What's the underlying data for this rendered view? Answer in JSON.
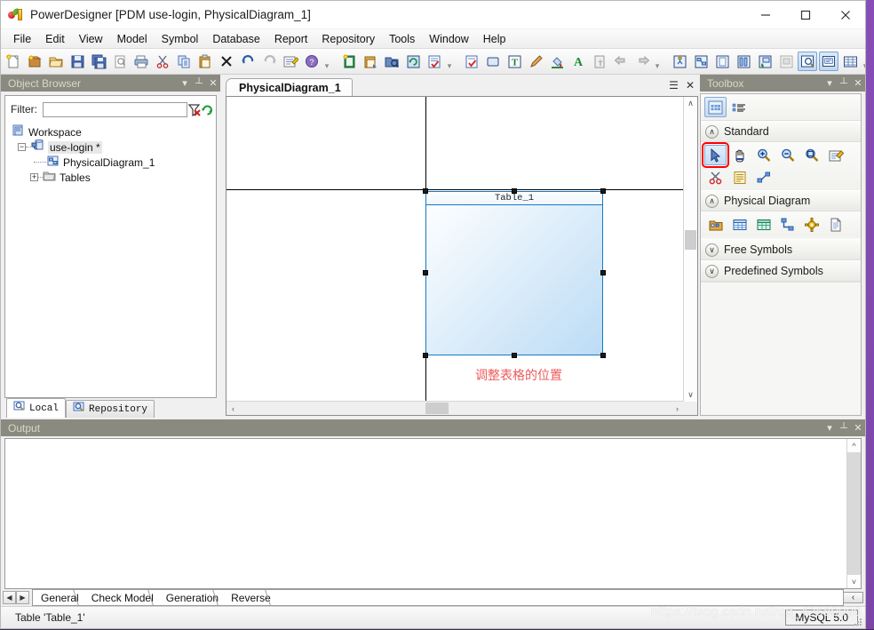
{
  "window": {
    "title": "PowerDesigner [PDM use-login, PhysicalDiagram_1]",
    "app_icon": "powerdesigner-icon",
    "minimize": "–",
    "maximize": "□",
    "close": "✕"
  },
  "menubar": {
    "items": [
      {
        "label": "File"
      },
      {
        "label": "Edit"
      },
      {
        "label": "View"
      },
      {
        "label": "Model"
      },
      {
        "label": "Symbol"
      },
      {
        "label": "Database"
      },
      {
        "label": "Report"
      },
      {
        "label": "Repository"
      },
      {
        "label": "Tools"
      },
      {
        "label": "Window"
      },
      {
        "label": "Help"
      }
    ]
  },
  "toolbar": {
    "group1": [
      "new-model-icon",
      "new-package-icon",
      "open-icon",
      "save-icon",
      "save-all-icon",
      "print-preview-icon",
      "print-icon",
      "cut-icon",
      "copy-icon",
      "paste-icon",
      "delete-icon",
      "undo-icon",
      "redo-icon",
      "properties-icon",
      "help-icon"
    ],
    "group2": [
      "new-diagram-icon",
      "paste-symbol-icon",
      "find-objects-icon",
      "refresh-icon",
      "check-model-icon"
    ],
    "group3": [
      "check-model2-icon",
      "symbol-format-icon",
      "text-format-icon",
      "pen-icon",
      "fill-color-icon",
      "font-color-icon",
      "export-icon",
      "previous-icon",
      "next-icon"
    ],
    "group4": [
      "display-preferences-icon",
      "auto-layout-icon",
      "page-icon",
      "align-icon",
      "fill-diagram-icon",
      "model-options-icon",
      "zoom-to-window-icon",
      "comment-icon",
      "grid-icon"
    ]
  },
  "browser": {
    "title": "Object Browser",
    "header_buttons": [
      "dropdown-icon",
      "pin-icon",
      "close-icon"
    ],
    "filter": {
      "label": "Filter:",
      "value": "",
      "placeholder": "",
      "clear_icon": "clear-filter-icon",
      "refresh_icon": "refresh-filter-icon"
    },
    "tree": [
      {
        "label": "Workspace",
        "icon": "workspace-icon",
        "depth": 0,
        "expander": "",
        "selected": false
      },
      {
        "label": "use-login *",
        "icon": "model-icon",
        "depth": 1,
        "expander": "−",
        "selected": true
      },
      {
        "label": "PhysicalDiagram_1",
        "icon": "diagram-icon",
        "depth": 2,
        "expander": "",
        "selected": false
      },
      {
        "label": "Tables",
        "icon": "folder-icon",
        "depth": 2,
        "expander": "+",
        "selected": false
      }
    ],
    "tabs": [
      {
        "label": "Local",
        "icon": "local-icon",
        "active": true
      },
      {
        "label": "Repository",
        "icon": "repository-icon",
        "active": false
      }
    ]
  },
  "diagram": {
    "tab_label": "PhysicalDiagram_1",
    "header_buttons": [
      "window-list-icon",
      "close-icon"
    ],
    "table_symbol": {
      "name": "Table_1",
      "selected": true,
      "border_color": "#1779c4",
      "fill_from": "#ffffff",
      "fill_to": "#bcdcf5"
    },
    "annotation": {
      "text": "调整表格的位置",
      "color": "#ec5b5b"
    },
    "scroll": {
      "up_arrow": "∧",
      "down_arrow": "∨",
      "left_arrow": "‹",
      "right_arrow": "›"
    }
  },
  "toolbox": {
    "title": "Toolbox",
    "header_buttons": [
      "dropdown-icon",
      "pin-icon",
      "close-icon"
    ],
    "top_row": [
      "palette-grid-icon",
      "palette-list-icon"
    ],
    "sections": [
      {
        "title": "Standard",
        "expanded": true,
        "chevron": "∧",
        "tools": [
          {
            "name": "pointer-tool",
            "selected": true,
            "highlighted": true
          },
          {
            "name": "grabber-tool",
            "selected": false,
            "highlighted": false
          },
          {
            "name": "zoom-in-tool",
            "selected": false,
            "highlighted": false
          },
          {
            "name": "zoom-out-tool",
            "selected": false,
            "highlighted": false
          },
          {
            "name": "zoom-window-tool",
            "selected": false,
            "highlighted": false
          },
          {
            "name": "properties-tool",
            "selected": false,
            "highlighted": false
          },
          {
            "name": "delete-tool",
            "selected": false,
            "highlighted": false
          },
          {
            "name": "note-tool",
            "selected": false,
            "highlighted": false
          },
          {
            "name": "link-tool",
            "selected": false,
            "highlighted": false
          }
        ]
      },
      {
        "title": "Physical Diagram",
        "expanded": true,
        "chevron": "∧",
        "tools": [
          {
            "name": "package-tool",
            "selected": false,
            "highlighted": false
          },
          {
            "name": "table-tool",
            "selected": false,
            "highlighted": false
          },
          {
            "name": "view-tool",
            "selected": false,
            "highlighted": false
          },
          {
            "name": "reference-tool",
            "selected": false,
            "highlighted": false
          },
          {
            "name": "procedure-tool",
            "selected": false,
            "highlighted": false
          },
          {
            "name": "file-tool",
            "selected": false,
            "highlighted": false
          }
        ]
      },
      {
        "title": "Free Symbols",
        "expanded": false,
        "chevron": "∨",
        "tools": []
      },
      {
        "title": "Predefined Symbols",
        "expanded": false,
        "chevron": "∨",
        "tools": []
      }
    ]
  },
  "output": {
    "title": "Output",
    "header_buttons": [
      "dropdown-icon",
      "pin-icon",
      "close-icon"
    ],
    "content": ""
  },
  "bottom_tabs": {
    "prev": "◀",
    "next": "▶",
    "collapse": "‹",
    "items": [
      {
        "label": "General",
        "active": true
      },
      {
        "label": "Check Model",
        "active": false
      },
      {
        "label": "Generation",
        "active": false
      },
      {
        "label": "Reverse",
        "active": false
      }
    ]
  },
  "statusbar": {
    "message": "Table 'Table_1'",
    "database": "MySQL 5.0"
  },
  "watermark": {
    "text": "https://blog.csdn.net/qq_42580990"
  }
}
